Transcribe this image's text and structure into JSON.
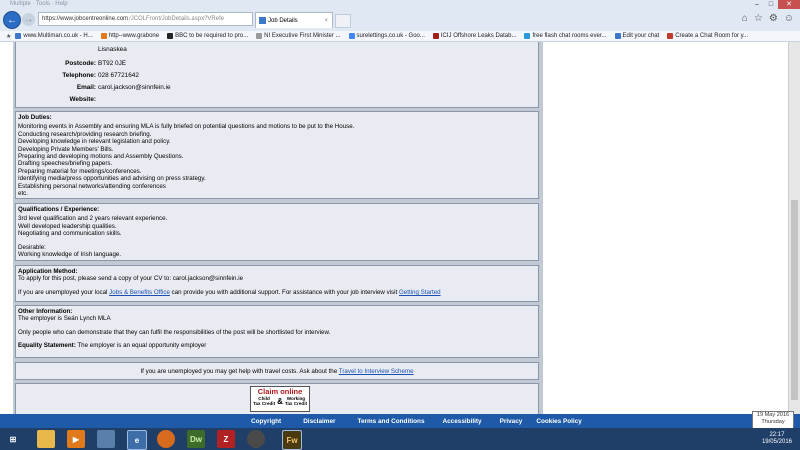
{
  "browser": {
    "menu_hint": "Multiple · Tools · Help",
    "url_domain": "https://www.jobcentreonline.com",
    "url_path": "/JCOLFront/JobDetails.aspx?VRefe",
    "tab_title": "Job Details",
    "favorites": [
      {
        "label": "www.Multiman.co.uk - H...",
        "color": "#3c78c8"
      },
      {
        "label": "http--www.grabone",
        "color": "#e07a1a"
      },
      {
        "label": "BBC to be required to pro...",
        "color": "#222222"
      },
      {
        "label": "NI Executive First Minister ...",
        "color": "#999999"
      },
      {
        "label": "surelettings.co.uk - Goo...",
        "color": "#4285f4"
      },
      {
        "label": "ICIJ Offshore Leaks Datab...",
        "color": "#a51c1c"
      },
      {
        "label": "free flash chat rooms ever...",
        "color": "#2a9bd8"
      },
      {
        "label": "Edit your chat",
        "color": "#3c78c8"
      },
      {
        "label": "Create a Chat Room for y...",
        "color": "#c0392b"
      }
    ]
  },
  "address": {
    "line": "Lisnaskea",
    "postcode_label": "Postcode:",
    "postcode": "BT92 0JE",
    "telephone_label": "Telephone:",
    "telephone": "028 67721642",
    "email_label": "Email:",
    "email": "carol.jackson@sinnfein.ie",
    "website_label": "Website:"
  },
  "duties": {
    "heading": "Job Duties:",
    "lines": [
      "Monitoring events in Assembly and ensuring MLA is fully briefed on potential questions and motions to be put to the House.",
      "Conducting research/providing research briefing.",
      "Developing knowledge in relevant legislation and policy.",
      "Developing Private Members' Bills.",
      "Preparing and developing motions and Assembly Questions.",
      "Drafting speeches/briefing papers.",
      "Preparing material for meetings/conferences.",
      "Identifying media/press opportunities and advising on press strategy.",
      "Establishing personal networks/attending conferences",
      "etc."
    ]
  },
  "qualifications": {
    "heading": "Qualifications / Experience:",
    "l1": "3rd level qualification and 2 years relevant experience.",
    "l2": "Well developed leadership qualities.",
    "l3": "Negotiating and communication skills.",
    "l4": "Desirable:",
    "l5": "Working knowledge of Irish language."
  },
  "application": {
    "heading": "Application Method:",
    "l1": "To apply for this post, please send a copy of your CV to: carol.jackson@sinnfein.ie",
    "l2a": "If you are unemployed your local ",
    "link1": "Jobs & Benefits Office",
    "l2b": " can provide you with additional support. For assistance with your job interview visit ",
    "link2": "Getting Started"
  },
  "other": {
    "heading": "Other Information:",
    "l1": "The employer is Seán Lynch MLA",
    "l2": "Only people who can demonstrate that they can fulfil the responsibilities of the post will be shortlisted for interview.",
    "eq_label": "Equality Statement:",
    "eq_text": " The employer is an equal opportunity employer"
  },
  "travel": {
    "text": "If you are unemployed you may get help with travel costs. Ask about the ",
    "link": "Travel to Interview Scheme"
  },
  "claim": {
    "title": "Claim online",
    "left": "Child\nTax Credit",
    "amp": "&",
    "right": "Working\nTax Credit"
  },
  "footer": {
    "links": [
      "Copyright",
      "Disclaimer",
      "Terms and Conditions",
      "Accessibility",
      "Privacy",
      "Cookies Policy"
    ]
  },
  "taskbar": {
    "time": "22:17",
    "date": "19/05/2016",
    "tooltip1": "19 May 2016",
    "tooltip2": "Thursday"
  }
}
